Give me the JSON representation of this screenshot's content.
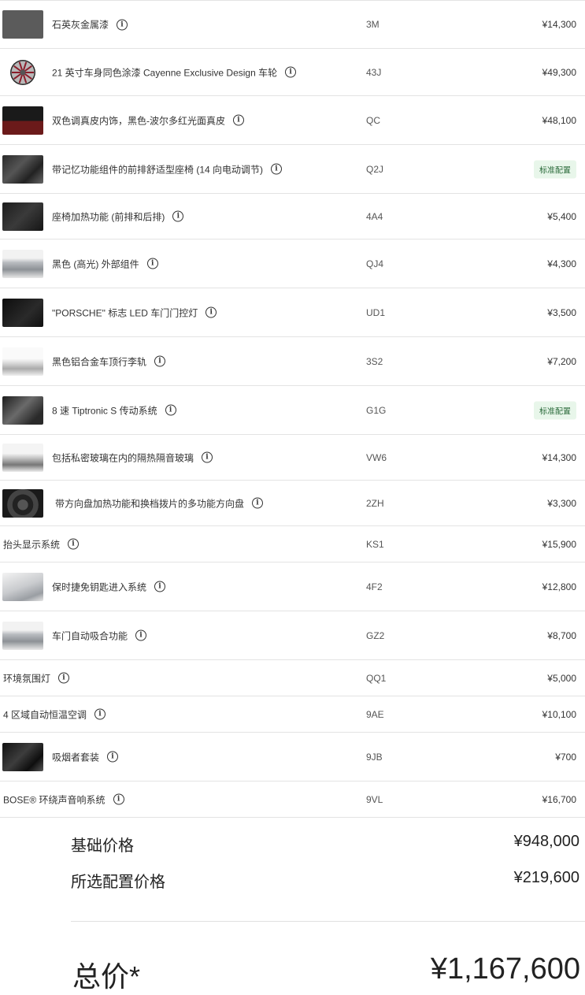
{
  "options": [
    {
      "name": "石英灰金属漆",
      "code": "3M",
      "price": "¥14,300",
      "thumb": "swatch-gray"
    },
    {
      "name": "21 英寸车身同色涂漆 Cayenne Exclusive Design 车轮",
      "code": "43J",
      "price": "¥49,300",
      "thumb": "wheel"
    },
    {
      "name": "双色调真皮内饰，黑色-波尔多红光面真皮",
      "code": "QC",
      "price": "¥48,100",
      "thumb": "swatch-red"
    },
    {
      "name": "带记忆功能组件的前排舒适型座椅 (14 向电动调节)",
      "code": "Q2J",
      "badge": "标准配置",
      "thumb": "seat"
    },
    {
      "name": "座椅加热功能 (前排和后排)",
      "code": "4A4",
      "price": "¥5,400",
      "thumb": "seat-dark"
    },
    {
      "name": "黑色 (高光) 外部组件",
      "code": "QJ4",
      "price": "¥4,300",
      "thumb": "car-silver"
    },
    {
      "name": "\"PORSCHE\" 标志 LED 车门门控灯",
      "code": "UD1",
      "price": "¥3,500",
      "thumb": "dark"
    },
    {
      "name": "黑色铝合金车顶行李轨",
      "code": "3S2",
      "price": "¥7,200",
      "thumb": "car-white"
    },
    {
      "name": "8 速 Tiptronic S 传动系统",
      "code": "G1G",
      "badge": "标准配置",
      "thumb": "gearbox"
    },
    {
      "name": "包括私密玻璃在内的隔热隔音玻璃",
      "code": "VW6",
      "price": "¥14,300",
      "thumb": "car-side"
    },
    {
      "name": "带方向盘加热功能和换档拨片的多功能方向盘",
      "code": "2ZH",
      "price": "¥3,300",
      "thumb": "steering"
    },
    {
      "name": "抬头显示系统",
      "code": "KS1",
      "price": "¥15,900",
      "thumb": "none"
    },
    {
      "name": "保时捷免钥匙进入系统",
      "code": "4F2",
      "price": "¥12,800",
      "thumb": "handle"
    },
    {
      "name": "车门自动吸合功能",
      "code": "GZ2",
      "price": "¥8,700",
      "thumb": "car-silver"
    },
    {
      "name": "环境氛围灯",
      "code": "QQ1",
      "price": "¥5,000",
      "thumb": "none"
    },
    {
      "name": "4 区域自动恒温空调",
      "code": "9AE",
      "price": "¥10,100",
      "thumb": "none"
    },
    {
      "name": "吸烟者套装",
      "code": "9JB",
      "price": "¥700",
      "thumb": "interior"
    },
    {
      "name": "BOSE® 环绕声音响系统",
      "code": "9VL",
      "price": "¥16,700",
      "thumb": "none"
    }
  ],
  "summary": {
    "base_label": "基础价格",
    "base_value": "¥948,000",
    "options_label": "所选配置价格",
    "options_value": "¥219,600",
    "total_label": "总价*",
    "total_value": "¥1,167,600"
  },
  "colors": {
    "badge_bg": "#e8f6ea",
    "badge_text": "#2b6b3b"
  }
}
